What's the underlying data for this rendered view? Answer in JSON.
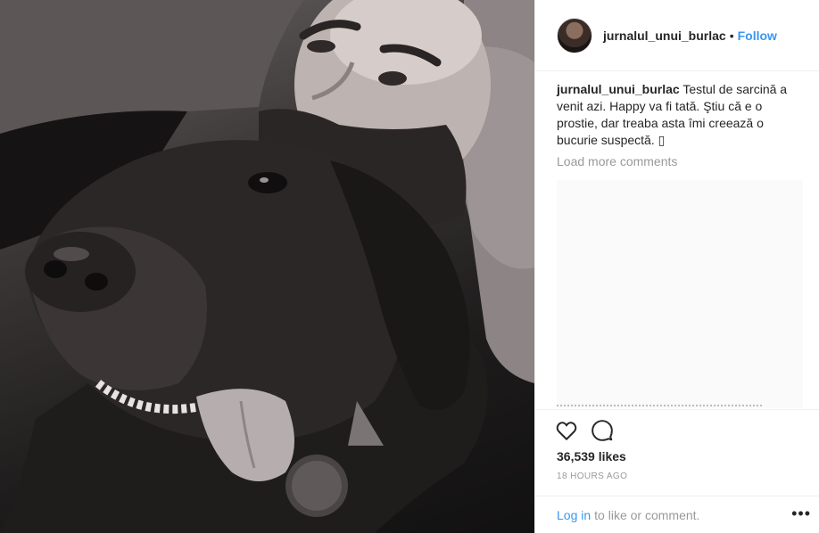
{
  "post": {
    "username": "jurnalul_unui_burlac",
    "separator": "•",
    "follow_label": "Follow",
    "caption_user": "jurnalul_unui_burlac",
    "caption_text": "Testul de sarcină a venit azi. Happy va fi tată. Ştiu că e o prostie, dar treaba asta îmi creează o bucurie suspectă. ▯",
    "load_more_label": "Load more comments",
    "likes": "36,539 likes",
    "timestamp": "18 HOURS AGO",
    "login_link": "Log in",
    "login_suffix": "to like or comment.",
    "more_label": "•••"
  },
  "icons": {
    "like": "heart-icon",
    "comment": "comment-icon",
    "more": "more-options-icon"
  },
  "colors": {
    "link": "#3897f0",
    "muted": "#999999",
    "text": "#262626"
  }
}
